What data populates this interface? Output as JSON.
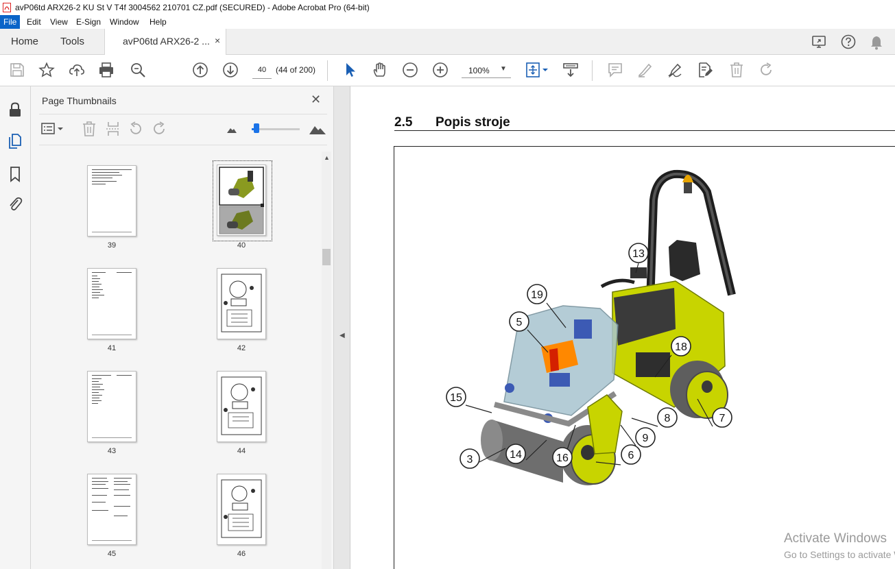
{
  "window": {
    "title": "avP06td ARX26-2 KU St V T4f 3004562 210701 CZ.pdf (SECURED) - Adobe Acrobat Pro (64-bit)"
  },
  "menu": [
    "File",
    "Edit",
    "View",
    "E-Sign",
    "Window",
    "Help"
  ],
  "tabs": {
    "home": "Home",
    "tools": "Tools",
    "document": "avP06td ARX26-2 ...",
    "close": "×"
  },
  "toolbar": {
    "page_number": "40",
    "page_count": "(44 of 200)",
    "zoom": "100%",
    "icons": [
      "save-icon",
      "bookmark-star-icon",
      "upload-icon",
      "print-icon",
      "zoom-search-icon",
      "previous-page-icon",
      "next-page-icon",
      "select-cursor-icon",
      "hand-icon",
      "zoom-out-icon",
      "zoom-in-icon",
      "fit-page-icon",
      "scroll-mode-icon",
      "comment-icon",
      "highlight-icon",
      "draw-icon",
      "edit-pdf-icon",
      "delete-icon",
      "redo-icon",
      "share-screen-icon",
      "help-icon",
      "notifications-icon"
    ]
  },
  "rail": [
    "lock-icon",
    "page-thumbnails-icon",
    "bookmarks-icon",
    "attachments-icon"
  ],
  "panel": {
    "title": "Page Thumbnails",
    "close": "✕",
    "thumbnail_size": 0.05,
    "thumbnails": [
      {
        "page": "39",
        "type": "text"
      },
      {
        "page": "40",
        "type": "image",
        "selected": true
      },
      {
        "page": "41",
        "type": "text"
      },
      {
        "page": "42",
        "type": "diagram"
      },
      {
        "page": "43",
        "type": "text"
      },
      {
        "page": "44",
        "type": "diagram"
      },
      {
        "page": "45",
        "type": "text"
      },
      {
        "page": "46",
        "type": "diagram"
      }
    ]
  },
  "document": {
    "section_number": "2.5",
    "section_title": "Popis stroje",
    "callouts": [
      "13",
      "19",
      "5",
      "18",
      "15",
      "8",
      "7",
      "9",
      "3",
      "14",
      "16",
      "6"
    ]
  },
  "watermark": {
    "line1": "Activate Windows",
    "line2": "Go to Settings to activate Windows."
  },
  "colors": {
    "accent": "#0a64c8",
    "machine_body": "#c8d400",
    "roller": "#6e6e6e"
  }
}
